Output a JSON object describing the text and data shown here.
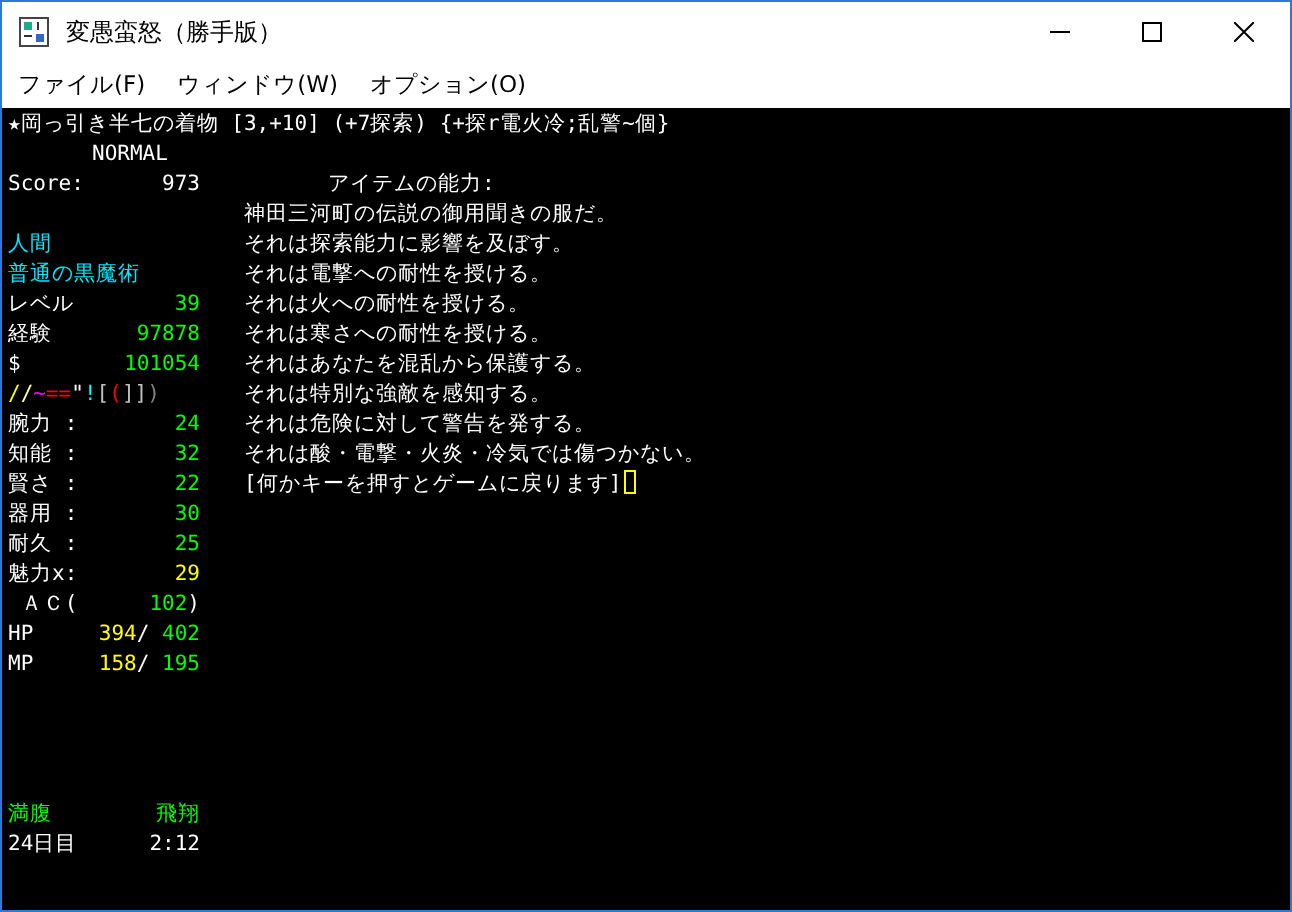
{
  "window": {
    "title": "変愚蛮怒（勝手版）"
  },
  "menu": [
    "ファイル(F)",
    "ウィンドウ(W)",
    "オプション(O)"
  ],
  "terminal": {
    "header": "★岡っ引き半七の着物 [3,+10] (+7探索) {+探r電火冷;乱警~個}",
    "mode": "NORMAL",
    "score": {
      "label": "Score:",
      "value": "973"
    },
    "status_lines": [
      {
        "label": [
          {
            "text": "人間",
            "color": "#00e8ff"
          }
        ]
      },
      {
        "label": [
          {
            "text": "普通の黒魔術",
            "color": "#00e8ff"
          }
        ]
      },
      {
        "label": [
          {
            "text": "レベル",
            "color": "#ffffff"
          }
        ],
        "value": [
          {
            "text": "39",
            "color": "#00ff00"
          }
        ]
      },
      {
        "label": [
          {
            "text": "経験",
            "color": "#ffffff"
          }
        ],
        "value": [
          {
            "text": "97878",
            "color": "#00ff00"
          }
        ]
      },
      {
        "label": [
          {
            "text": "$",
            "color": "#ffffff"
          }
        ],
        "value": [
          {
            "text": "101054",
            "color": "#00ff00"
          }
        ]
      },
      {
        "label": [
          {
            "text": "/",
            "color": "#ffff00"
          },
          {
            "text": "/",
            "color": "#ffffa0"
          },
          {
            "text": "~",
            "color": "#ff00ff"
          },
          {
            "text": "==",
            "color": "#ff0000"
          },
          {
            "text": "\"",
            "color": "#ffffff"
          },
          {
            "text": "!",
            "color": "#00ffff"
          },
          {
            "text": "[",
            "color": "#c0c0c0"
          },
          {
            "text": "(",
            "color": "#ff0000"
          },
          {
            "text": "]]",
            "color": "#c0c0c0"
          },
          {
            "text": ")",
            "color": "#808080"
          }
        ]
      },
      {
        "label": [
          {
            "text": "腕力 :",
            "color": "#ffffff"
          }
        ],
        "value": [
          {
            "text": "24",
            "color": "#00ff00"
          }
        ]
      },
      {
        "label": [
          {
            "text": "知能 :",
            "color": "#ffffff"
          }
        ],
        "value": [
          {
            "text": "32",
            "color": "#00ff00"
          }
        ]
      },
      {
        "label": [
          {
            "text": "賢さ :",
            "color": "#ffffff"
          }
        ],
        "value": [
          {
            "text": "22",
            "color": "#00ff00"
          }
        ]
      },
      {
        "label": [
          {
            "text": "器用 :",
            "color": "#ffffff"
          }
        ],
        "value": [
          {
            "text": "30",
            "color": "#00ff00"
          }
        ]
      },
      {
        "label": [
          {
            "text": "耐久 :",
            "color": "#ffffff"
          }
        ],
        "value": [
          {
            "text": "25",
            "color": "#00ff00"
          }
        ]
      },
      {
        "label": [
          {
            "text": "魅力x:",
            "color": "#ffffff"
          }
        ],
        "value": [
          {
            "text": "29",
            "color": "#ffff00"
          }
        ]
      },
      {
        "label": [
          {
            "text": " ＡＣ(",
            "color": "#ffffff"
          }
        ],
        "value": [
          {
            "text": "102",
            "color": "#00ff00"
          },
          {
            "text": ")",
            "color": "#ffffff"
          }
        ]
      },
      {
        "label": [
          {
            "text": "HP",
            "color": "#ffffff"
          }
        ],
        "value": [
          {
            "text": "394",
            "color": "#ffff00"
          },
          {
            "text": "/",
            "color": "#ffffff"
          },
          {
            "text": " 402",
            "color": "#00ff00"
          }
        ]
      },
      {
        "label": [
          {
            "text": "MP",
            "color": "#ffffff"
          }
        ],
        "value": [
          {
            "text": "158",
            "color": "#ffff00"
          },
          {
            "text": "/",
            "color": "#ffffff"
          },
          {
            "text": " 195",
            "color": "#00ff00"
          }
        ]
      }
    ],
    "bottom_status": [
      {
        "text": "満腹",
        "color": "#00ff00"
      },
      {
        "text": "飛翔",
        "color": "#00ff00"
      }
    ],
    "game_time": [
      {
        "text": "24日目",
        "color": "#ffffff"
      },
      {
        "text": "2:12",
        "color": "#ffffff"
      }
    ],
    "item_title": "アイテムの能力:",
    "item_lines": [
      "神田三河町の伝説の御用聞きの服だ。",
      "それは探索能力に影響を及ぼす。",
      "それは電撃への耐性を授ける。",
      "それは火への耐性を授ける。",
      "それは寒さへの耐性を授ける。",
      "それはあなたを混乱から保護する。",
      "それは特別な強敵を感知する。",
      "それは危険に対して警告を発する。",
      "それは酸・電撃・火炎・冷気では傷つかない。"
    ],
    "prompt": "[何かキーを押すとゲームに戻ります]"
  }
}
